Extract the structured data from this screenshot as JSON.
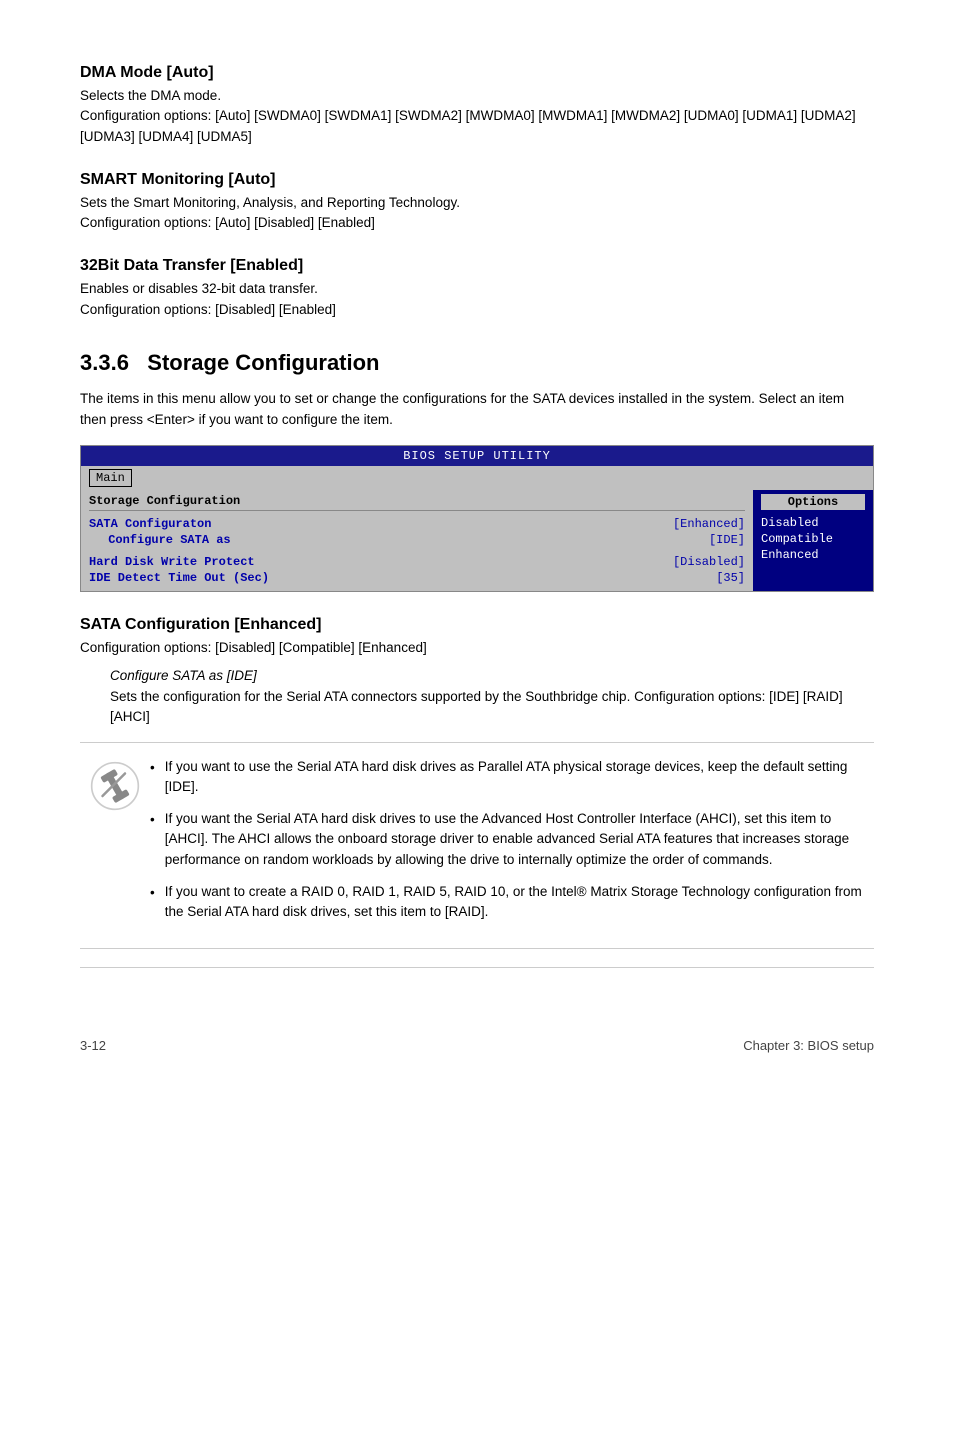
{
  "dma_mode": {
    "heading": "DMA Mode [Auto]",
    "description": "Selects the DMA mode.",
    "config_options": "Configuration options: [Auto] [SWDMA0] [SWDMA1] [SWDMA2] [MWDMA0] [MWDMA1] [MWDMA2] [UDMA0] [UDMA1] [UDMA2] [UDMA3] [UDMA4] [UDMA5]"
  },
  "smart_monitoring": {
    "heading": "SMART Monitoring [Auto]",
    "description": "Sets the Smart Monitoring, Analysis, and Reporting Technology.",
    "config_options": "Configuration options: [Auto] [Disabled] [Enabled]"
  },
  "bit32_transfer": {
    "heading": "32Bit Data Transfer [Enabled]",
    "description": "Enables or disables 32-bit data transfer.",
    "config_options": "Configuration options: [Disabled] [Enabled]"
  },
  "storage_config_section": {
    "number": "3.3.6",
    "title": "Storage Configuration",
    "intro": "The items in this menu allow you to set or change the configurations for the SATA devices installed in the system. Select an item then press <Enter> if you want to configure the item."
  },
  "bios_box": {
    "title_bar": "BIOS SETUP UTILITY",
    "menu_item": "Main",
    "section_header": "Storage Configuration",
    "options_header": "Options",
    "rows": [
      {
        "label": "SATA Configuraton",
        "value": "[Enhanced]"
      },
      {
        "label": " Configure SATA as",
        "value": "[IDE]"
      },
      {
        "label": "Hard Disk Write Protect",
        "value": "[Disabled]"
      },
      {
        "label": "IDE Detect Time Out (Sec)",
        "value": "[35]"
      }
    ],
    "options_list": [
      "Disabled",
      "Compatible",
      "Enhanced"
    ]
  },
  "sata_config": {
    "heading": "SATA Configuration [Enhanced]",
    "config_options": "Configuration options: [Disabled] [Compatible] [Enhanced]",
    "configure_italic": "Configure SATA as [IDE]",
    "configure_body": "Sets the configuration for the Serial ATA connectors supported by the Southbridge chip. Configuration options: [IDE] [RAID] [AHCI]"
  },
  "bullets": [
    "If you want to use the Serial ATA hard disk drives as Parallel ATA physical storage devices, keep the default setting [IDE].",
    "If you want the Serial ATA hard disk drives to use the Advanced Host Controller Interface (AHCI), set this item to [AHCI]. The AHCI allows the onboard storage driver to enable advanced Serial ATA features that increases storage performance on random workloads by allowing the drive to internally optimize the order of commands.",
    "If you want to create a RAID 0, RAID 1, RAID 5, RAID 10, or the Intel® Matrix Storage Technology configuration from the Serial ATA hard disk drives, set this item to [RAID]."
  ],
  "footer": {
    "page_number": "3-12",
    "chapter": "Chapter 3: BIOS setup"
  }
}
